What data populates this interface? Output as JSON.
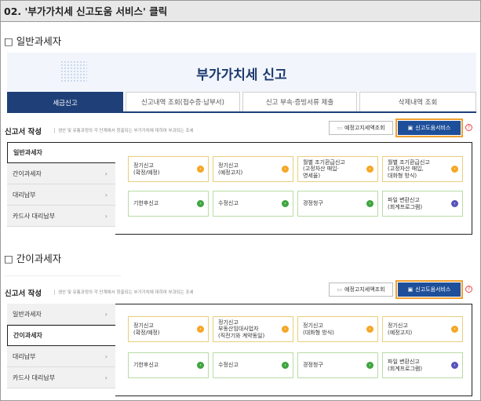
{
  "header": {
    "title": "02. '부가가치세 신고도움 서비스' 클릭"
  },
  "section1": {
    "label": "□ 일반과세자"
  },
  "section2": {
    "label": "□ 간이과세자"
  },
  "banner": {
    "title": "부가가치세 신고"
  },
  "tabs": [
    "세금신고",
    "신고내역 조회(접수증·납부서)",
    "신고 부속·증빙서류 제출",
    "삭제내역 조회"
  ],
  "report": {
    "title": "신고서 작성",
    "desc": "생산 및 유통과정의 각 단계에서 창출되는 부가가치에 대하여 부과되는 조세",
    "btn_notice": "예정고지세액조회",
    "btn_help": "신고도움서비스",
    "help_mark": "?"
  },
  "sidebar": [
    "일반과세자",
    "간이과세자",
    "대리납부",
    "카드사 대리납부"
  ],
  "chev": "›",
  "arrow": "›",
  "cards1": [
    "정기신고\n(확정/예정)",
    "정기신고\n(예정고지)",
    "월별 조기환급신고\n(고정자산 매입·\n영세율)",
    "월별 조기환급신고\n(고정자산 매입,\n대화형 방식)",
    "기한후신고",
    "수정신고",
    "경정청구",
    "파일 변환신고\n(회계프로그램)"
  ],
  "cards2": [
    "정기신고\n(확정/예정)",
    "정기신고\n부동산임대사업자\n(직전기와 계약동일)",
    "정기신고\n(대화형 방식)",
    "정기신고\n(예정고지)",
    "기한후신고",
    "수정신고",
    "경정청구",
    "파일 변환신고\n(회계프로그램)"
  ],
  "colors": {
    "navy": "#1e3f78",
    "help_btn": "#1e4f9a",
    "highlight": "#f0a030",
    "yellow_border": "#e9cf7a",
    "green_border": "#b8dca4"
  },
  "icons": {
    "notice": "document-icon",
    "help": "monitor-icon"
  }
}
